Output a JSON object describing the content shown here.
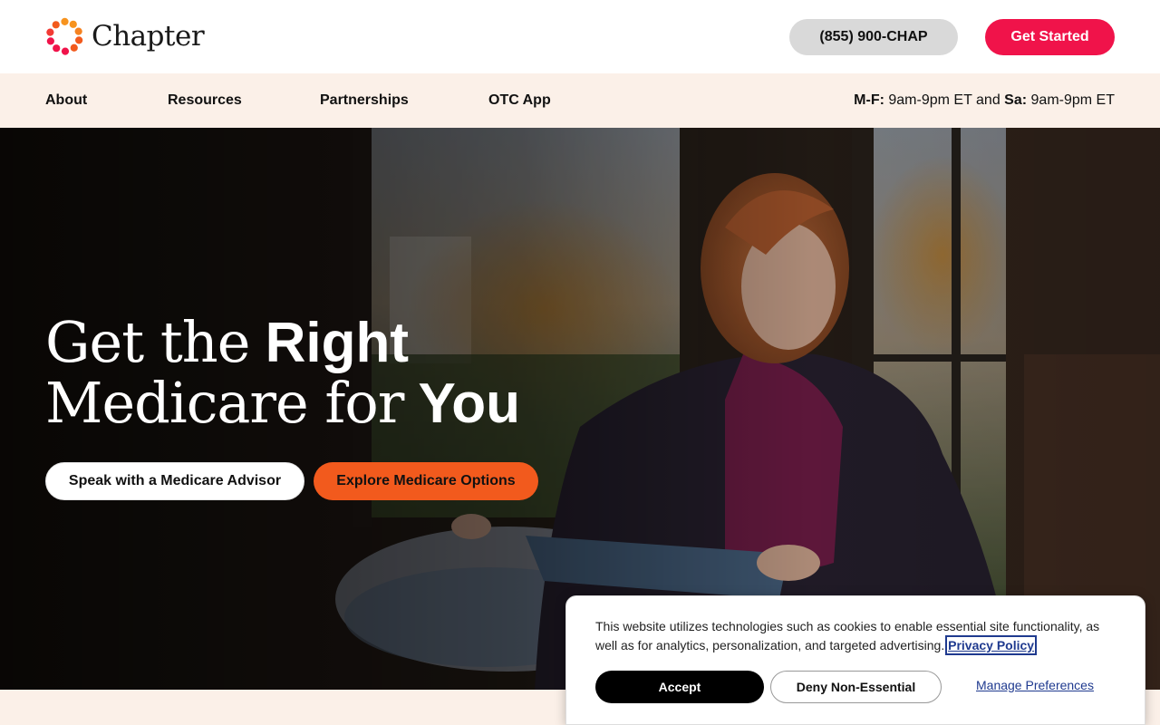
{
  "brand": {
    "name": "Chapter",
    "logo_colors": [
      "#f0134a",
      "#f25a1d",
      "#f7931e"
    ]
  },
  "header": {
    "phone_label": "(855) 900-CHAP",
    "cta_label": "Get Started"
  },
  "nav": {
    "items": [
      {
        "label": "About"
      },
      {
        "label": "Resources"
      },
      {
        "label": "Partnerships"
      },
      {
        "label": "OTC App"
      }
    ],
    "hours": {
      "weekday_label": "M-F:",
      "weekday_hours": "9am-9pm ET",
      "and_text": "and",
      "saturday_label": "Sa:",
      "saturday_hours": "9am-9pm ET"
    }
  },
  "hero": {
    "title_line1_light": "Get the",
    "title_line1_bold": "Right",
    "title_line2_light": "Medicare for",
    "title_line2_bold": "You",
    "advisor_button": "Speak with a Medicare Advisor",
    "explore_button": "Explore Medicare Options"
  },
  "cookie_banner": {
    "text": "This website utilizes technologies such as cookies to enable essential site functionality, as well as for analytics, personalization, and targeted advertising.",
    "privacy_link": "Privacy Policy",
    "accept": "Accept",
    "deny": "Deny Non-Essential",
    "manage": "Manage Preferences"
  },
  "colors": {
    "accent_red": "#f0134a",
    "accent_orange": "#f25a1d",
    "cream": "#fbf0e8",
    "link_blue": "#1f3a8f"
  }
}
